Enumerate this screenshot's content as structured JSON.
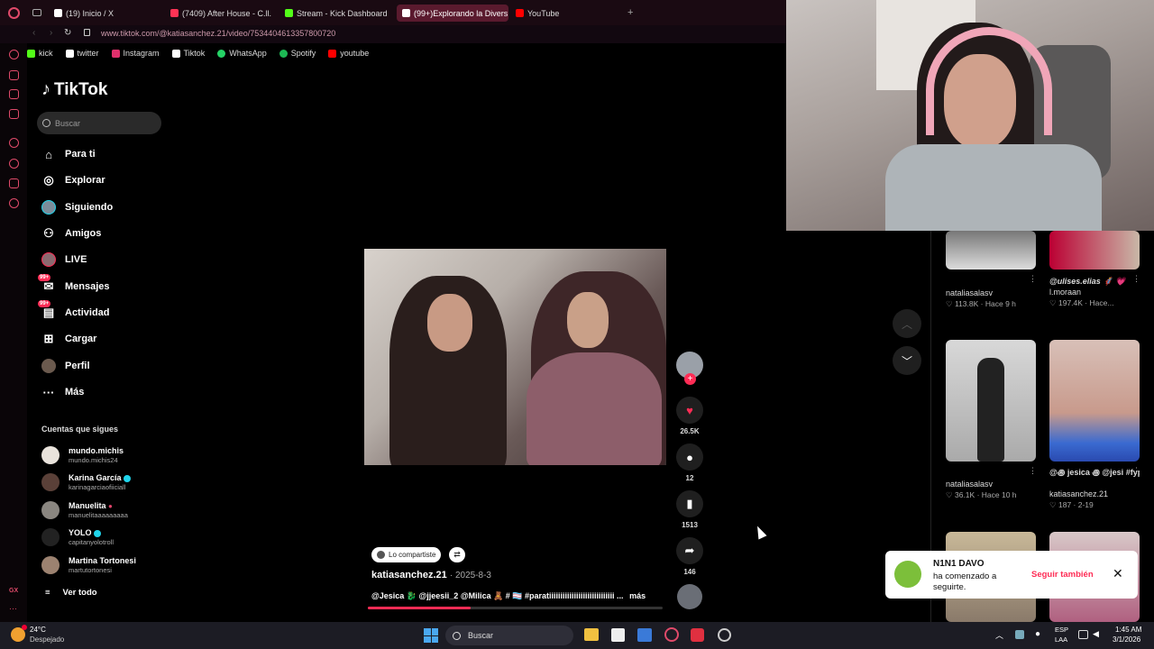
{
  "browser": {
    "tabs": [
      {
        "label": "(19) Inicio / X",
        "color": "#ffffff"
      },
      {
        "label": "(7409) After House - C.ll.",
        "color": "#ff3355"
      },
      {
        "label": "Stream - Kick Dashboard",
        "color": "#53fc18"
      },
      {
        "label": "(99+)Explorando la Divers",
        "color": "#ffffff"
      },
      {
        "label": "YouTube",
        "color": "#ff0000"
      }
    ],
    "active_tab_index": 3,
    "url": "www.tiktok.com/@katiasanchez.21/video/7534404613357800720",
    "bookmarks": [
      {
        "label": "kick",
        "color": "#53fc18"
      },
      {
        "label": "twitter",
        "color": "#ffffff"
      },
      {
        "label": "Instagram",
        "color": "#e1306c"
      },
      {
        "label": "Tiktok",
        "color": "#ffffff"
      },
      {
        "label": "WhatsApp",
        "color": "#25d366"
      },
      {
        "label": "Spotify",
        "color": "#1db954"
      },
      {
        "label": "youtube",
        "color": "#ff0000"
      }
    ],
    "gx_label": "GX"
  },
  "tiktok": {
    "logo": "TikTok",
    "search_placeholder": "Buscar",
    "nav": [
      {
        "label": "Para ti",
        "icon": "home-icon",
        "glyph": "⌂"
      },
      {
        "label": "Explorar",
        "icon": "compass-icon",
        "glyph": "◎"
      },
      {
        "label": "Siguiendo",
        "icon": "following-avatar-icon",
        "glyph": "●"
      },
      {
        "label": "Amigos",
        "icon": "friends-icon",
        "glyph": "👥"
      },
      {
        "label": "LIVE",
        "icon": "live-icon",
        "glyph": "●"
      },
      {
        "label": "Mensajes",
        "icon": "messages-icon",
        "glyph": "✉",
        "badge": "99+"
      },
      {
        "label": "Actividad",
        "icon": "activity-icon",
        "glyph": "▤",
        "badge": "99+"
      },
      {
        "label": "Cargar",
        "icon": "upload-icon",
        "glyph": "⊞"
      },
      {
        "label": "Perfil",
        "icon": "profile-avatar-icon",
        "glyph": "●"
      },
      {
        "label": "Más",
        "icon": "more-icon",
        "glyph": "···"
      }
    ],
    "following_title": "Cuentas que sigues",
    "following": [
      {
        "name": "mundo.michis",
        "handle": "mundo.michis24",
        "verified": false
      },
      {
        "name": "Karina García",
        "handle": "karinagarciaofiiciall",
        "verified": true
      },
      {
        "name": "Manuelita",
        "handle": "manuelitaaaaaaaaa",
        "verified": false
      },
      {
        "name": "YOLO",
        "handle": "capitanyolotroll",
        "verified": true
      },
      {
        "name": "Martina Tortonesi",
        "handle": "martutortonesi",
        "verified": false
      }
    ],
    "see_all": "Ver todo",
    "video": {
      "shared_chip": "Lo compartiste",
      "author": "katiasanchez.21",
      "date": "· 2025-8-3",
      "caption": "@Jesica 🐉 @jjeesii_2 @Milica 🧸 # 🏳️‍⚧️ #paratiiiiiiiiiiiiiiiiiiiiiiiiiiiii ...",
      "more": "más",
      "progress": 0.35,
      "likes": "26.5K",
      "comments": "12",
      "saves": "1513",
      "shares": "146"
    },
    "grid": [
      {
        "user": "nataliasalasv",
        "likes": "113.8K",
        "age": "Hace 9 h"
      },
      {
        "user": "@ulises.elias",
        "likes": "197.4K",
        "age": "Hace...",
        "handle": "l.moraan",
        "caption": "@ulises.elias 🦸 💗"
      },
      {
        "user": "nataliasalasv",
        "likes": "36.1K",
        "age": "Hace 10 h"
      },
      {
        "user": "katiasanchez.21",
        "likes": "187",
        "age": "2-19",
        "caption": "@꩜ jesica ꩜ @jesi #fypシ #parati..."
      }
    ],
    "toast": {
      "name": "N1N1 DAVO",
      "message": "ha comenzado a seguirte.",
      "button": "Seguir también"
    }
  },
  "taskbar": {
    "temp": "24°C",
    "weather": "Despejado",
    "search": "Buscar",
    "lang1": "ESP",
    "lang2": "LAA",
    "time": "1:45 AM",
    "date": "3/1/2026"
  }
}
